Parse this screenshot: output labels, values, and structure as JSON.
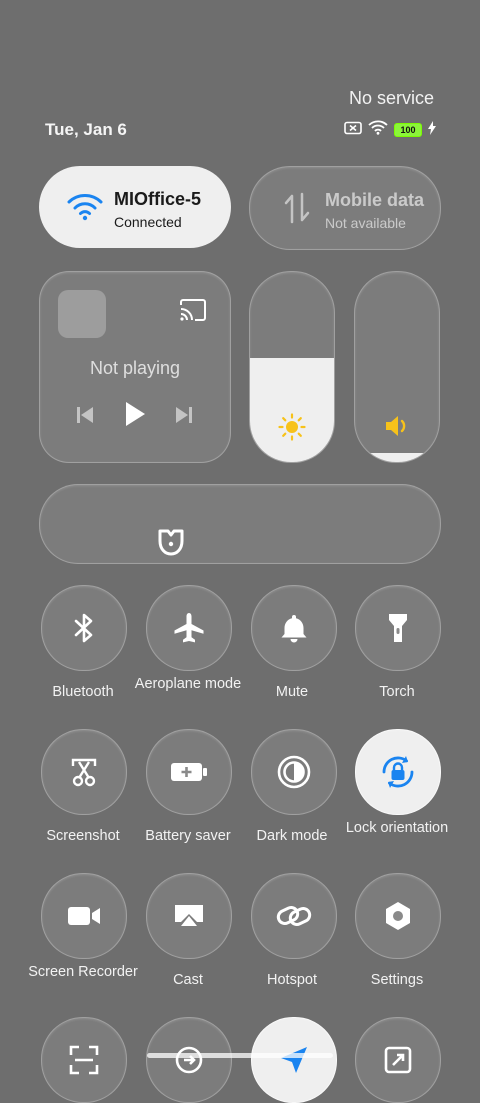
{
  "status_bar": {
    "carrier": "No service",
    "date": "Tue, Jan 6",
    "battery_level": "100",
    "icons": [
      "no-sim-icon",
      "wifi-icon",
      "battery-icon",
      "charging-icon"
    ]
  },
  "wifi": {
    "name": "MIOffice-5",
    "status": "Connected",
    "active": true
  },
  "mobile_data": {
    "name": "Mobile data",
    "status": "Not available",
    "active": false
  },
  "media": {
    "status": "Not playing"
  },
  "brightness": {
    "level": 0.55
  },
  "volume": {
    "level": 0.05
  },
  "toggles": [
    {
      "id": "bluetooth",
      "label": "Bluetooth",
      "active": false,
      "icon": "bluetooth-icon"
    },
    {
      "id": "aeroplane",
      "label": "Aeroplane mode",
      "active": false,
      "icon": "airplane-icon"
    },
    {
      "id": "mute",
      "label": "Mute",
      "active": false,
      "icon": "bell-icon"
    },
    {
      "id": "torch",
      "label": "Torch",
      "active": false,
      "icon": "flashlight-icon"
    },
    {
      "id": "screenshot",
      "label": "Screenshot",
      "active": false,
      "icon": "scissors-icon"
    },
    {
      "id": "battery_saver",
      "label": "Battery saver",
      "active": false,
      "icon": "battery-plus-icon"
    },
    {
      "id": "dark_mode",
      "label": "Dark mode",
      "active": false,
      "icon": "dark-mode-icon"
    },
    {
      "id": "lock_orientation",
      "label": "Lock orientation",
      "active": true,
      "icon": "rotation-lock-icon"
    },
    {
      "id": "screen_recorder",
      "label": "Screen Recorder",
      "active": false,
      "icon": "video-camera-icon"
    },
    {
      "id": "cast",
      "label": "Cast",
      "active": false,
      "icon": "cast-icon"
    },
    {
      "id": "hotspot",
      "label": "Hotspot",
      "active": false,
      "icon": "link-icon"
    },
    {
      "id": "settings",
      "label": "Settings",
      "active": false,
      "icon": "gear-icon"
    }
  ],
  "colors": {
    "accent": "#1a84f0",
    "sun": "#f7c21a",
    "panel_bg": "#6e6e6e",
    "active_bg": "#efefef"
  }
}
